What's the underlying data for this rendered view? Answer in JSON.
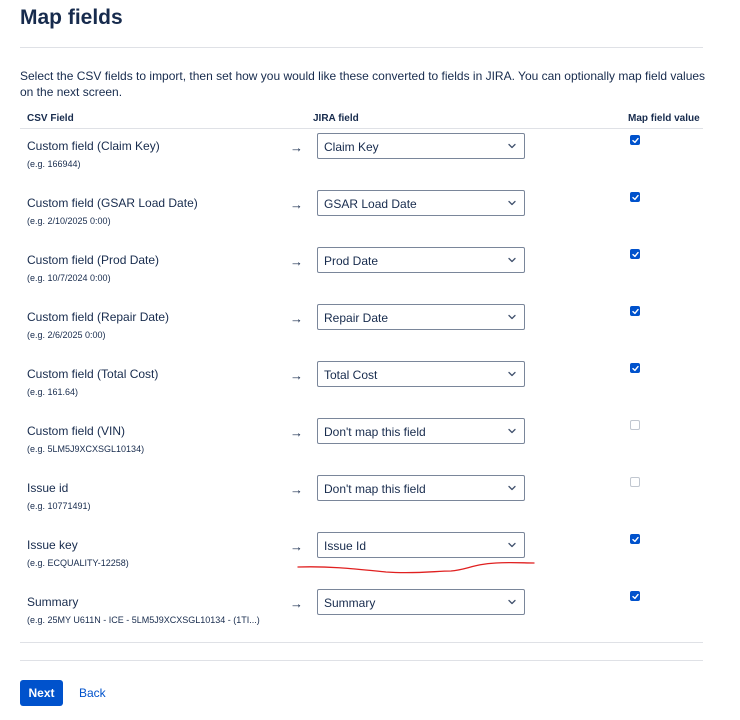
{
  "page": {
    "title": "Map fields",
    "intro": "Select the CSV fields to import, then set how you would like these converted to fields in JIRA. You can optionally map field values on the next screen."
  },
  "columns": {
    "csv_field": "CSV Field",
    "jira_field": "JIRA field",
    "map_value": "Map field value"
  },
  "arrow_glyph": "→",
  "rows": [
    {
      "name": "Custom field (Claim Key)",
      "example": "(e.g. 166944)",
      "jira_field": "Claim Key",
      "map_value": true
    },
    {
      "name": "Custom field (GSAR Load Date)",
      "example": "(e.g. 2/10/2025 0:00)",
      "jira_field": "GSAR Load Date",
      "map_value": true
    },
    {
      "name": "Custom field (Prod Date)",
      "example": "(e.g. 10/7/2024 0:00)",
      "jira_field": "Prod Date",
      "map_value": true
    },
    {
      "name": "Custom field (Repair Date)",
      "example": "(e.g. 2/6/2025 0:00)",
      "jira_field": "Repair Date",
      "map_value": true
    },
    {
      "name": "Custom field (Total Cost)",
      "example": "(e.g. 161.64)",
      "jira_field": "Total Cost",
      "map_value": true
    },
    {
      "name": "Custom field (VIN)",
      "example": "(e.g. 5LM5J9XCXSGL10134)",
      "jira_field": "Don't map this field",
      "map_value": false
    },
    {
      "name": "Issue id",
      "example": "(e.g. 10771491)",
      "jira_field": "Don't map this field",
      "map_value": false
    },
    {
      "name": "Issue key",
      "example": "(e.g. ECQUALITY-12258)",
      "jira_field": "Issue Id",
      "map_value": true
    },
    {
      "name": "Summary",
      "example": "(e.g. 25MY U611N - ICE - 5LM5J9XCXSGL10134 - (1TI...)",
      "jira_field": "Summary",
      "map_value": true
    }
  ],
  "buttons": {
    "next": "Next",
    "back": "Back"
  },
  "icons": {
    "select_chevron": "chevron-down-icon",
    "checkbox_check": "check-icon"
  },
  "colors": {
    "primary": "#0052cc",
    "text": "#172b4d",
    "annotation": "#e02020"
  }
}
